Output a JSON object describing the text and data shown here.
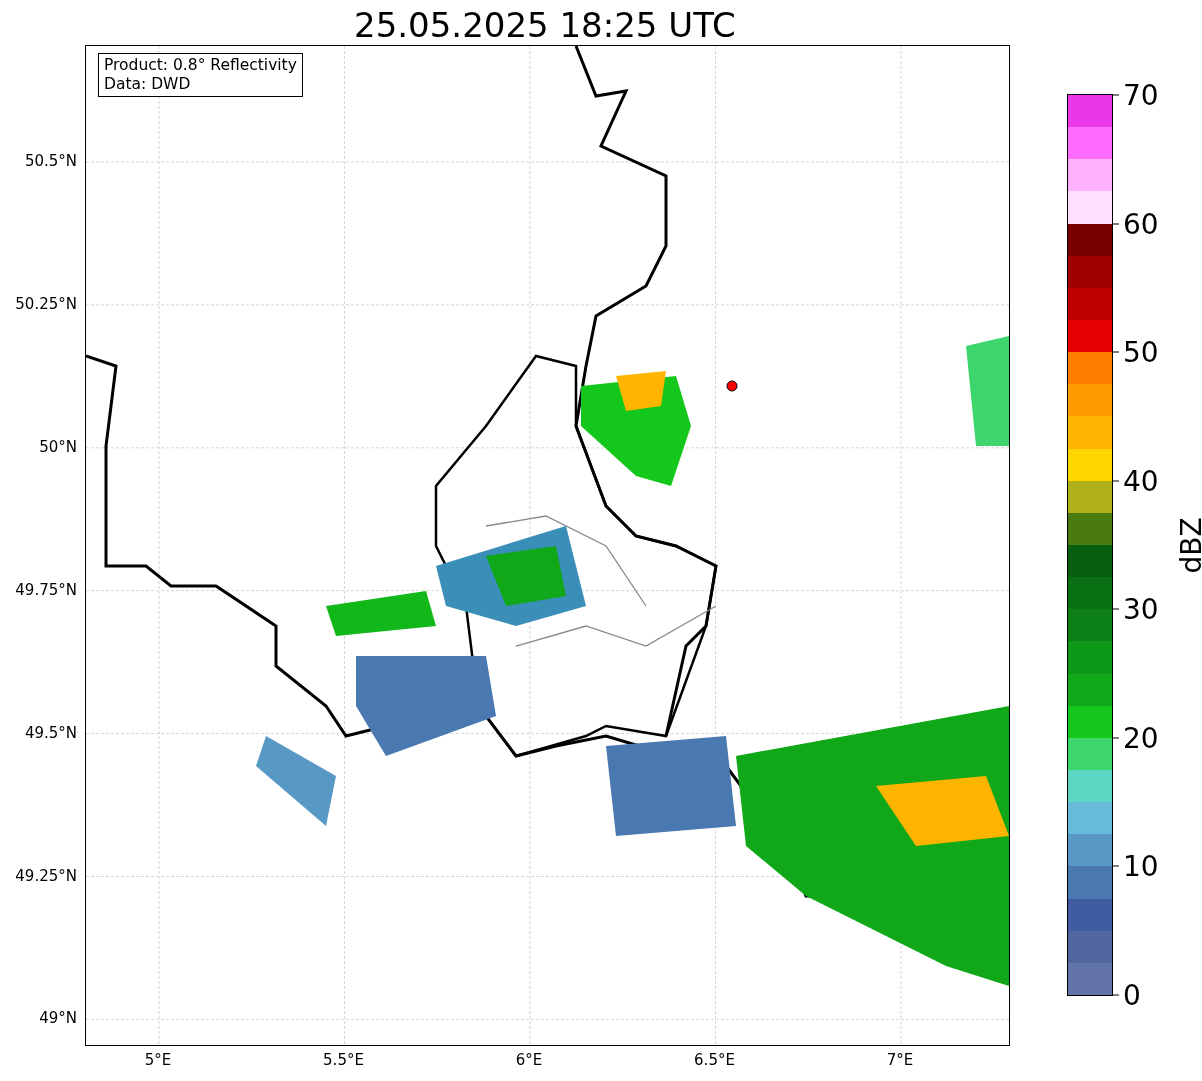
{
  "title": "25.05.2025 18:25 UTC",
  "info_box": {
    "lines": [
      "Product: 0.8° Reflectivity",
      "Data: DWD"
    ]
  },
  "map": {
    "lat_labels": [
      "50.5°N",
      "50.25°N",
      "50°N",
      "49.75°N",
      "49.5°N",
      "49.25°N",
      "49°N"
    ],
    "lon_labels": [
      "5°E",
      "5.5°E",
      "6°E",
      "6.5°E",
      "7°E"
    ]
  },
  "colorbar": {
    "label": "dBZ",
    "ticks": [
      "70",
      "60",
      "50",
      "40",
      "30",
      "20",
      "10",
      "0"
    ],
    "bins": [
      {
        "color": "#6374a8"
      },
      {
        "color": "#52679f"
      },
      {
        "color": "#415ba0"
      },
      {
        "color": "#4a78b0"
      },
      {
        "color": "#5898c4"
      },
      {
        "color": "#66bcd8"
      },
      {
        "color": "#5dd6c4"
      },
      {
        "color": "#3cd66c"
      },
      {
        "color": "#13c81a"
      },
      {
        "color": "#10a818"
      },
      {
        "color": "#0e9818"
      },
      {
        "color": "#0c8016"
      },
      {
        "color": "#0a7014"
      },
      {
        "color": "#085e10"
      },
      {
        "color": "#4a7a10"
      },
      {
        "color": "#b0b018"
      },
      {
        "color": "#ffd700"
      },
      {
        "color": "#ffb400"
      },
      {
        "color": "#ff9a00"
      },
      {
        "color": "#ff7d00"
      },
      {
        "color": "#e40000"
      },
      {
        "color": "#c00000"
      },
      {
        "color": "#a00000"
      },
      {
        "color": "#7a0000"
      },
      {
        "color": "#ffe0ff"
      },
      {
        "color": "#ffb0ff"
      },
      {
        "color": "#ff6cff"
      },
      {
        "color": "#e838e8"
      }
    ]
  }
}
